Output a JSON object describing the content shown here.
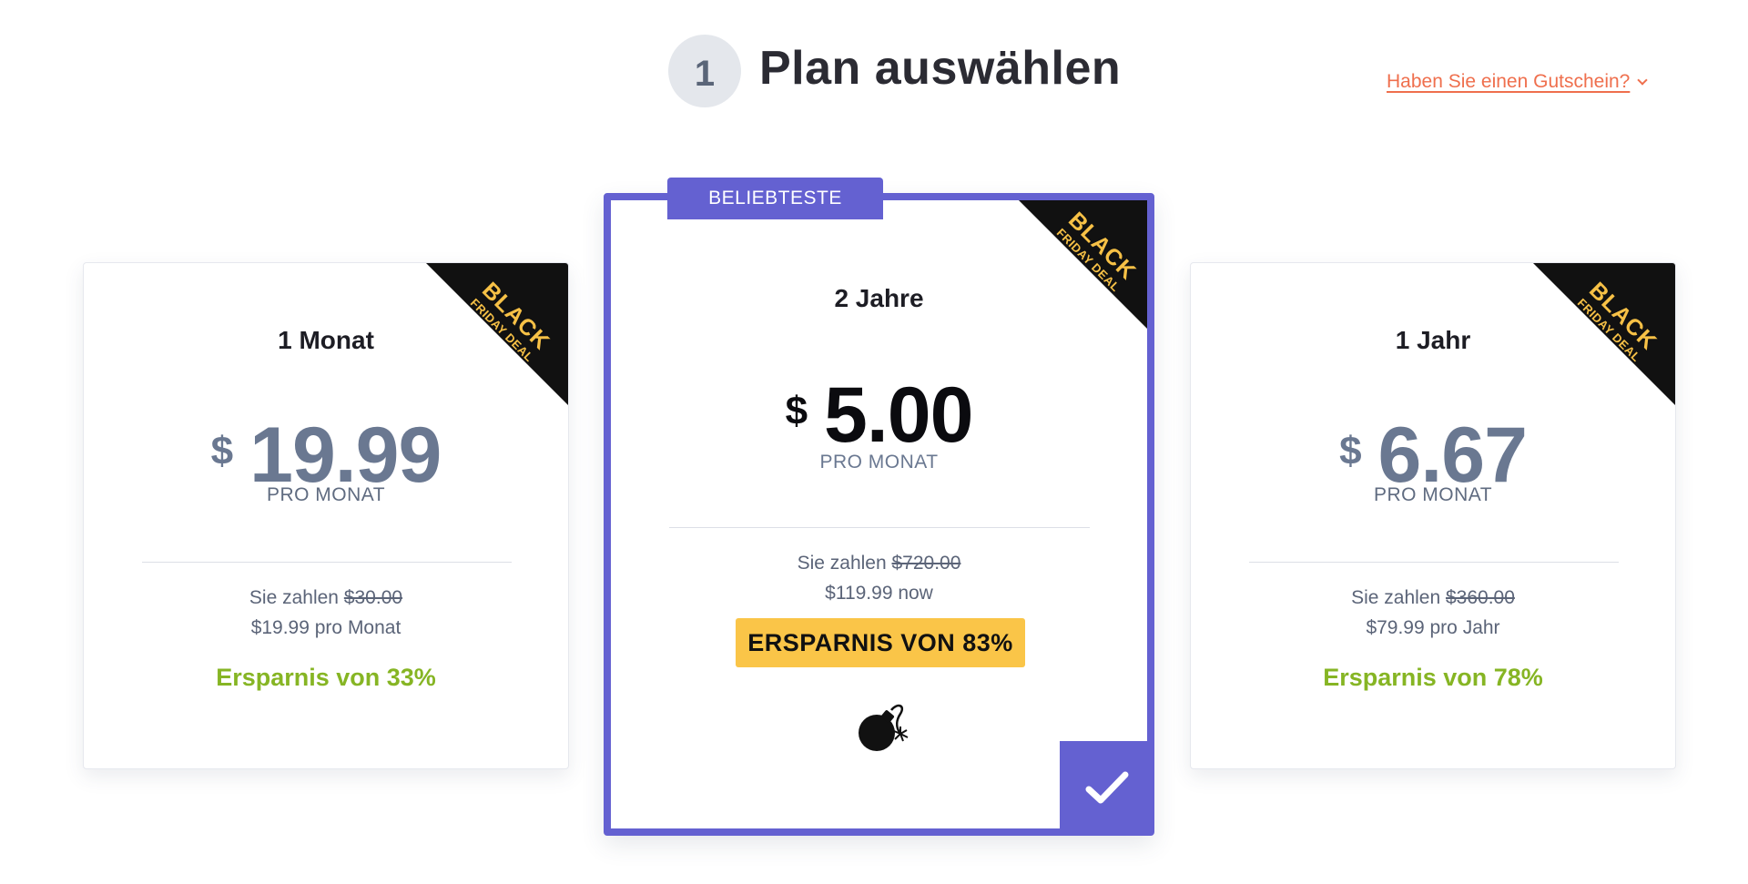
{
  "header": {
    "step_number": "1",
    "title": "Plan auswählen",
    "coupon_link": "Haben Sie einen Gutschein?"
  },
  "ribbon": {
    "line1": "BLACK",
    "line2": "FRIDAY DEAL"
  },
  "plans": [
    {
      "name": "1 Monat",
      "currency": "$",
      "price": "19.99",
      "period": "PRO MONAT",
      "pay_prefix": "Sie zahlen ",
      "pay_old": "$30.00",
      "pay_now": "$19.99 pro Monat",
      "savings": "Ersparnis von 33%"
    },
    {
      "name": "2 Jahre",
      "badge": "BELIEBTESTE",
      "currency": "$",
      "price": "5.00",
      "period": "PRO MONAT",
      "pay_prefix": "Sie zahlen ",
      "pay_old": "$720.00",
      "pay_now": "$119.99 now",
      "savings": "ERSPARNIS VON 83%",
      "selected": true,
      "icon": "bomb-icon"
    },
    {
      "name": "1 Jahr",
      "currency": "$",
      "price": "6.67",
      "period": "PRO MONAT",
      "pay_prefix": "Sie zahlen ",
      "pay_old": "$360.00",
      "pay_now": "$79.99 pro Jahr",
      "savings": "Ersparnis von 78%"
    }
  ],
  "colors": {
    "accent": "#6461d1",
    "coupon": "#ef6f4d",
    "savings_green": "#86b524",
    "badge_yellow": "#fac548",
    "ribbon_text": "#f7c146",
    "price_muted": "#6a7891"
  }
}
